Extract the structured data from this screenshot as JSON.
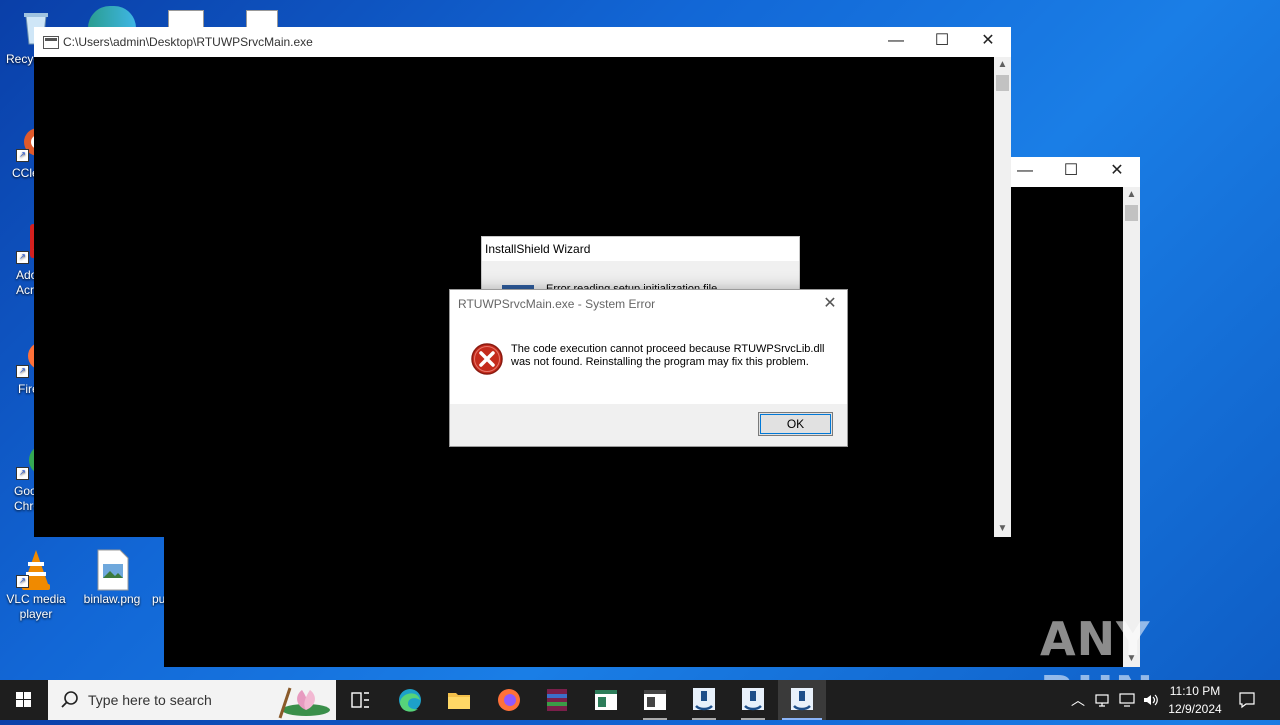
{
  "desktop": {
    "icons": [
      {
        "label": "Recycle Bin"
      },
      {
        "label": "CCleaner"
      },
      {
        "label": "Adobe Acrobat"
      },
      {
        "label": "Firefox"
      },
      {
        "label": "Google Chrome"
      },
      {
        "label": "VLC media player"
      },
      {
        "label": "binlaw.png"
      },
      {
        "label": "pu"
      }
    ]
  },
  "console_main": {
    "title": "C:\\Users\\admin\\Desktop\\RTUWPSrvcMain.exe",
    "minimize": "—",
    "maximize": "☐",
    "close": "✕"
  },
  "console_back": {
    "minimize": "—",
    "maximize": "☐",
    "close": "✕"
  },
  "installshield": {
    "title": "InstallShield Wizard",
    "message": "Error reading setup initialization file"
  },
  "error_dialog": {
    "title": "RTUWPSrvcMain.exe - System Error",
    "close": "✕",
    "message": "The code execution cannot proceed because RTUWPSrvcLib.dll was not found. Reinstalling the program may fix this problem.",
    "ok_label": "OK",
    "icon": "error-icon",
    "icon_color": "#c42b1c"
  },
  "taskbar": {
    "search_placeholder": "Type here to search",
    "time": "11:10 PM",
    "date": "12/9/2024"
  },
  "watermark": "ANY RUN"
}
